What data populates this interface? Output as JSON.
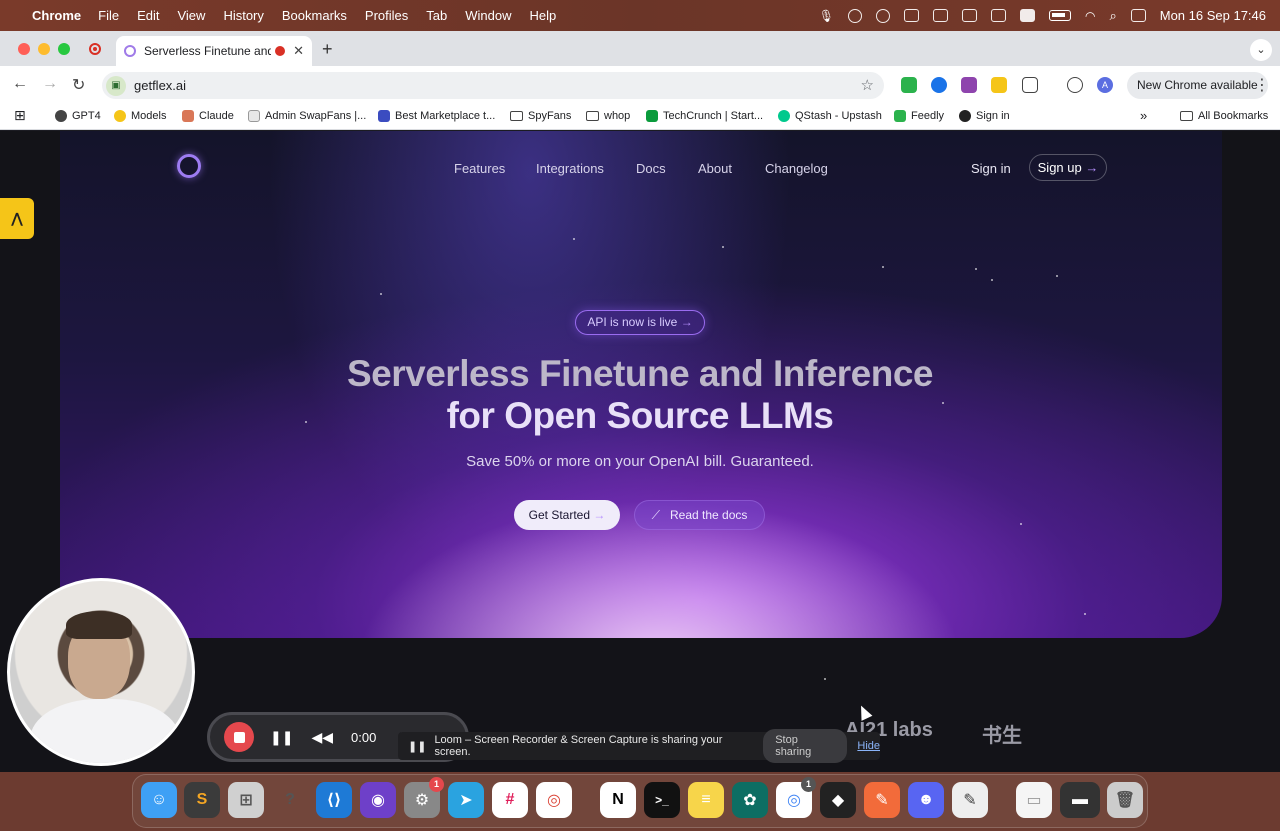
{
  "menubar": {
    "app": "Chrome",
    "items": [
      "File",
      "Edit",
      "View",
      "History",
      "Bookmarks",
      "Profiles",
      "Tab",
      "Window",
      "Help"
    ],
    "datetime": "Mon 16 Sep  17:46"
  },
  "browser": {
    "tab_title": "Serverless Finetune and I",
    "url": "getflex.ai",
    "new_chrome": "New Chrome available",
    "avatar_letter": "A",
    "bookmarks": [
      "GPT4",
      "Models",
      "Claude",
      "Admin SwapFans |...",
      "Best Marketplace t...",
      "SpyFans",
      "whop",
      "TechCrunch | Start...",
      "QStash - Upstash",
      "Feedly",
      "Sign in"
    ],
    "all_bookmarks": "All Bookmarks"
  },
  "site": {
    "nav": [
      "Features",
      "Integrations",
      "Docs",
      "About",
      "Changelog"
    ],
    "sign_in": "Sign in",
    "sign_up": "Sign up",
    "announcement": "API is now is live",
    "headline_line1": "Serverless Finetune and Inference",
    "headline_line2": "for Open Source LLMs",
    "subheadline": "Save 50% or more on your OpenAI bill. Guaranteed.",
    "cta_primary": "Get Started",
    "cta_secondary": "Read the docs",
    "logos": [
      "AI21 labs",
      "书生"
    ]
  },
  "loom": {
    "timer": "0:00",
    "share_message": "Loom – Screen Recorder & Screen Capture is sharing your screen.",
    "stop_sharing": "Stop sharing",
    "hide": "Hide"
  },
  "dock": {
    "badges": {
      "settings": "1",
      "chrome": "1"
    }
  },
  "colors": {
    "accent": "#9d7cf2",
    "menubar_bg": "#6b3528",
    "record_red": "#e5484d"
  }
}
